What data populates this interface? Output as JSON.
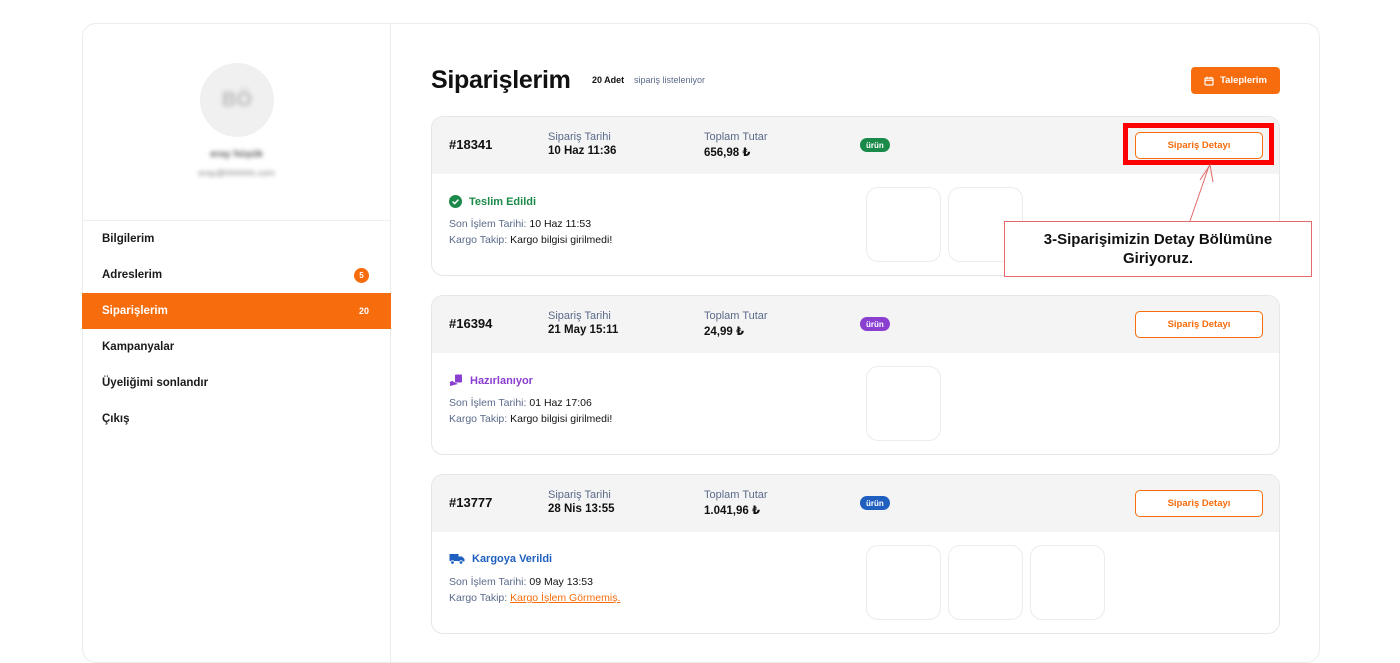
{
  "sidebar": {
    "avatar_initials": "BÖ",
    "user_name": "eray hüşük",
    "user_email": "eray@hhhhhh.com",
    "items": [
      {
        "label": "Bilgilerim",
        "badge": ""
      },
      {
        "label": "Adreslerim",
        "badge": "5"
      },
      {
        "label": "Siparişlerim",
        "badge": "20"
      },
      {
        "label": "Kampanyalar",
        "badge": ""
      },
      {
        "label": "Üyeliğimi sonlandır",
        "badge": ""
      },
      {
        "label": "Çıkış",
        "badge": ""
      }
    ]
  },
  "header": {
    "title": "Siparişlerim",
    "count": "20 Adet",
    "count_sub": "sipariş listeleniyor",
    "requests_button": "Taleplerim"
  },
  "labels": {
    "date": "Sipariş Tarihi",
    "total": "Toplam Tutar",
    "last_action": "Son İşlem Tarihi:",
    "cargo": "Kargo Takip:",
    "detail_button": "Sipariş Detayı",
    "pill": "ürün"
  },
  "orders": [
    {
      "no": "#18341",
      "date": "10 Haz 11:36",
      "total": "656,98 ₺",
      "status": "Teslim Edildi",
      "last_action": "10 Haz 11:53",
      "cargo": "Kargo bilgisi girilmedi!"
    },
    {
      "no": "#16394",
      "date": "21 May 15:11",
      "total": "24,99 ₺",
      "status": "Hazırlanıyor",
      "last_action": "01 Haz 17:06",
      "cargo": "Kargo bilgisi girilmedi!"
    },
    {
      "no": "#13777",
      "date": "28 Nis 13:55",
      "total": "1.041,96 ₺",
      "status": "Kargoya Verildi",
      "last_action": "09 May 13:53",
      "cargo": "Kargo İşlem Görmemiş."
    }
  ],
  "annotation": {
    "line1": "3-Siparişimizin Detay Bölümüne",
    "line2": "Giriyoruz."
  },
  "colors": {
    "accent": "#f76c0c",
    "delivered": "#1a8a4a",
    "preparing": "#8a3fd1",
    "shipped": "#1f5fbf",
    "annotation": "#ff0000"
  }
}
